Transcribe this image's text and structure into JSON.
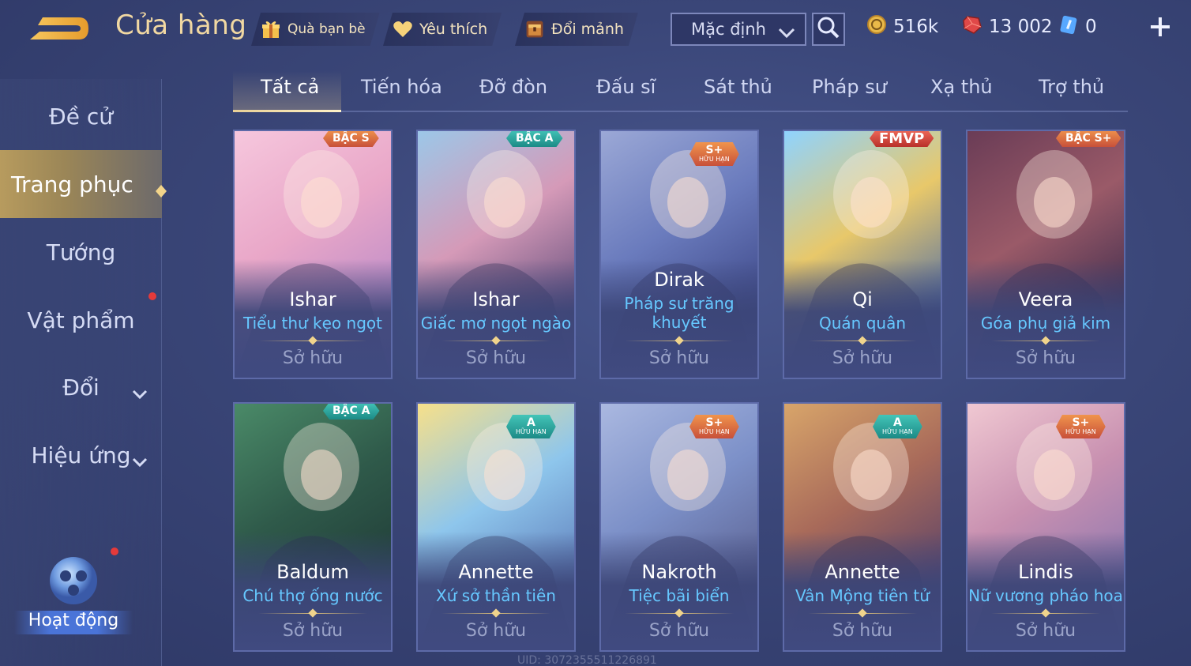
{
  "header": {
    "title": "Cửa hàng",
    "gift_label": "Quà bạn bè",
    "favorite_label": "Yêu thích",
    "exchange_label": "Đổi mảnh",
    "sort_selected": "Mặc định",
    "gold": "516k",
    "gems": "13 002",
    "vouchers": "0"
  },
  "sidebar": {
    "items": [
      {
        "label": "Đề cử"
      },
      {
        "label": "Trang phục"
      },
      {
        "label": "Tướng"
      },
      {
        "label": "Vật phẩm"
      },
      {
        "label": "Đổi"
      },
      {
        "label": "Hiệu ứng"
      }
    ],
    "activity_label": "Hoạt động"
  },
  "tabs": [
    {
      "label": "Tất cả"
    },
    {
      "label": "Tiến hóa"
    },
    {
      "label": "Đỡ đòn"
    },
    {
      "label": "Đấu sĩ"
    },
    {
      "label": "Sát thủ"
    },
    {
      "label": "Pháp sư"
    },
    {
      "label": "Xạ thủ"
    },
    {
      "label": "Trợ thủ"
    }
  ],
  "cards": [
    {
      "hero": "Ishar",
      "skin": "Tiểu thư kẹo ngọt",
      "status": "Sở hữu",
      "badge": "BẬC S",
      "limited": ""
    },
    {
      "hero": "Ishar",
      "skin": "Giấc mơ ngọt ngào",
      "status": "Sở hữu",
      "badge": "BẬC A",
      "limited": ""
    },
    {
      "hero": "Dirak",
      "skin": "Pháp sư trăng khuyết",
      "status": "Sở hữu",
      "badge": "S+",
      "limited": "HỮU HẠN"
    },
    {
      "hero": "Qi",
      "skin": "Quán quân",
      "status": "Sở hữu",
      "badge": "FMVP",
      "limited": ""
    },
    {
      "hero": "Veera",
      "skin": "Góa phụ giả kim",
      "status": "Sở hữu",
      "badge": "BẬC S+",
      "limited": ""
    },
    {
      "hero": "Baldum",
      "skin": "Chú thợ ống nước",
      "status": "Sở hữu",
      "badge": "BẬC A",
      "limited": ""
    },
    {
      "hero": "Annette",
      "skin": "Xứ sở thần tiên",
      "status": "Sở hữu",
      "badge": "A",
      "limited": "HỮU HẠN"
    },
    {
      "hero": "Nakroth",
      "skin": "Tiệc bãi biển",
      "status": "Sở hữu",
      "badge": "S+",
      "limited": "HỮU HẠN"
    },
    {
      "hero": "Annette",
      "skin": "Vân Mộng tiên tử",
      "status": "Sở hữu",
      "badge": "A",
      "limited": "HỮU HẠN"
    },
    {
      "hero": "Lindis",
      "skin": "Nữ vương pháo hoa",
      "status": "Sở hữu",
      "badge": "S+",
      "limited": "HỮU HẠN"
    }
  ],
  "uid": "UID: 3072355511226891",
  "colors": {
    "accent_gold": "#f1d8a2",
    "skin_name": "#66c8ff",
    "badge_s": "#e0703f",
    "badge_a": "#2aa7a0"
  }
}
